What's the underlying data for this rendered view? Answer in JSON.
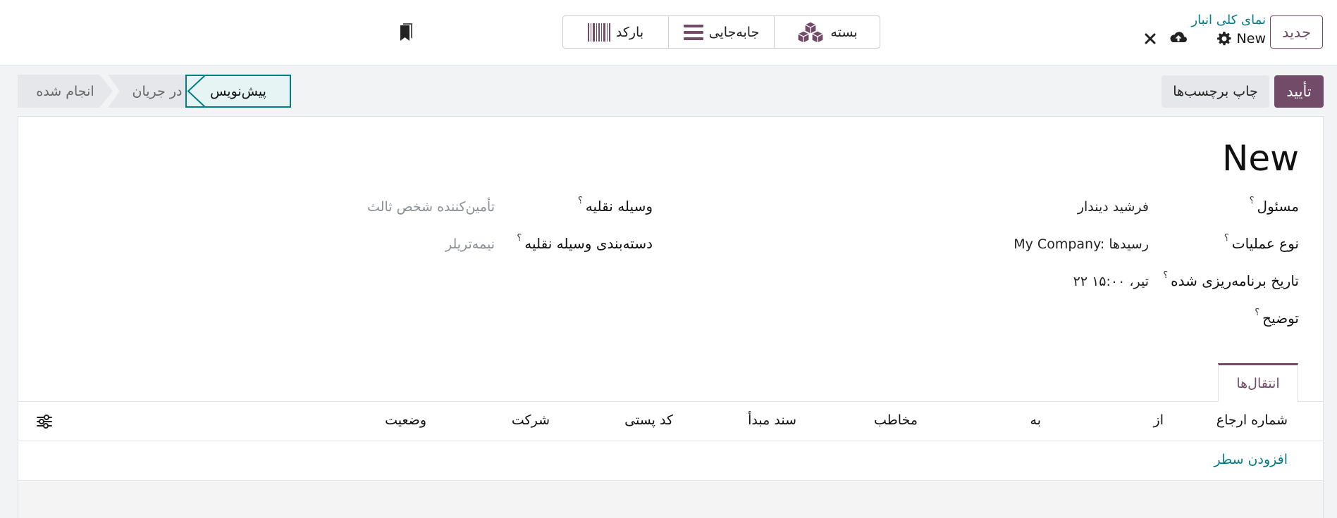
{
  "topbar": {
    "new_button": "جدید",
    "breadcrumb_parent": "نمای کلی انبار",
    "breadcrumb_current": "New",
    "actions": {
      "settings_icon": "gear-icon",
      "save_icon": "cloud-upload-icon",
      "discard_icon": "close-icon"
    },
    "segments": [
      {
        "label": "بسته",
        "icon": "cubes-icon"
      },
      {
        "label": "جابه‌جایی",
        "icon": "list-icon"
      },
      {
        "label": "بارکد",
        "icon": "barcode-icon"
      }
    ],
    "bookmark_icon": "bookmark-icon"
  },
  "control": {
    "confirm": "تأیید",
    "print_labels": "چاپ برچسب‌ها",
    "stages": {
      "draft": "پیش‌نویس",
      "in_progress": "در جریان",
      "done": "انجام شده"
    },
    "active_stage": "draft"
  },
  "form": {
    "title": "New",
    "fields": {
      "responsible": {
        "label": "مسئول",
        "value": "فرشید دیندار"
      },
      "operation_type": {
        "label": "نوع عملیات",
        "value": "My Company: رسیدها"
      },
      "scheduled_date": {
        "label": "تاریخ برنامه‌ریزی شده",
        "value": "۲۲ تیر، ۱۵:۰۰"
      },
      "description": {
        "label": "توضیح",
        "value": ""
      },
      "vehicle": {
        "label": "وسیله نقلیه",
        "placeholder": "تأمین‌کننده شخص ثالث"
      },
      "vehicle_category": {
        "label": "دسته‌بندی وسیله نقلیه",
        "placeholder": "نیمه‌تریلر"
      }
    },
    "help_mark": "؟"
  },
  "tabs": [
    {
      "label": "انتقال‌ها",
      "active": true
    }
  ],
  "table": {
    "columns": [
      "شماره ارجاع",
      "از",
      "به",
      "مخاطب",
      "سند مبدأ",
      "کد پستی",
      "شرکت",
      "وضعیت"
    ],
    "add_line": "افزودن سطر",
    "optional_columns_icon": "sliders-icon"
  },
  "colors": {
    "brand": "#714b67",
    "accent": "#017e84"
  }
}
